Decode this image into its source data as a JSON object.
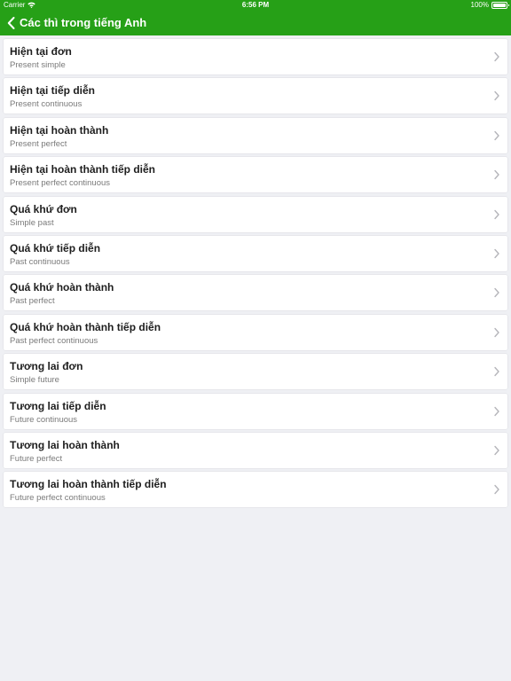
{
  "status": {
    "carrier": "Carrier",
    "time": "6:56 PM",
    "battery": "100%"
  },
  "nav": {
    "title": "Các thì trong tiếng Anh",
    "back_icon": "chevron-left-icon"
  },
  "colors": {
    "brand": "#26a017",
    "background": "#eff0f4"
  },
  "items": [
    {
      "title": "Hiện tại đơn",
      "subtitle": "Present simple"
    },
    {
      "title": "Hiện tại tiếp diễn",
      "subtitle": "Present continuous"
    },
    {
      "title": "Hiện tại hoàn thành",
      "subtitle": "Present perfect"
    },
    {
      "title": "Hiện tại hoàn thành tiếp diễn",
      "subtitle": "Present perfect continuous"
    },
    {
      "title": "Quá khứ đơn",
      "subtitle": "Simple past"
    },
    {
      "title": "Quá khứ tiếp diễn",
      "subtitle": "Past continuous"
    },
    {
      "title": "Quá khứ hoàn thành",
      "subtitle": "Past perfect"
    },
    {
      "title": "Quá khứ hoàn thành tiếp diễn",
      "subtitle": "Past perfect continuous"
    },
    {
      "title": "Tương lai đơn",
      "subtitle": "Simple future"
    },
    {
      "title": "Tương lai tiếp diễn",
      "subtitle": "Future continuous"
    },
    {
      "title": "Tương lai hoàn thành",
      "subtitle": "Future perfect"
    },
    {
      "title": "Tương lai hoàn thành tiếp diễn",
      "subtitle": "Future perfect continuous"
    }
  ]
}
